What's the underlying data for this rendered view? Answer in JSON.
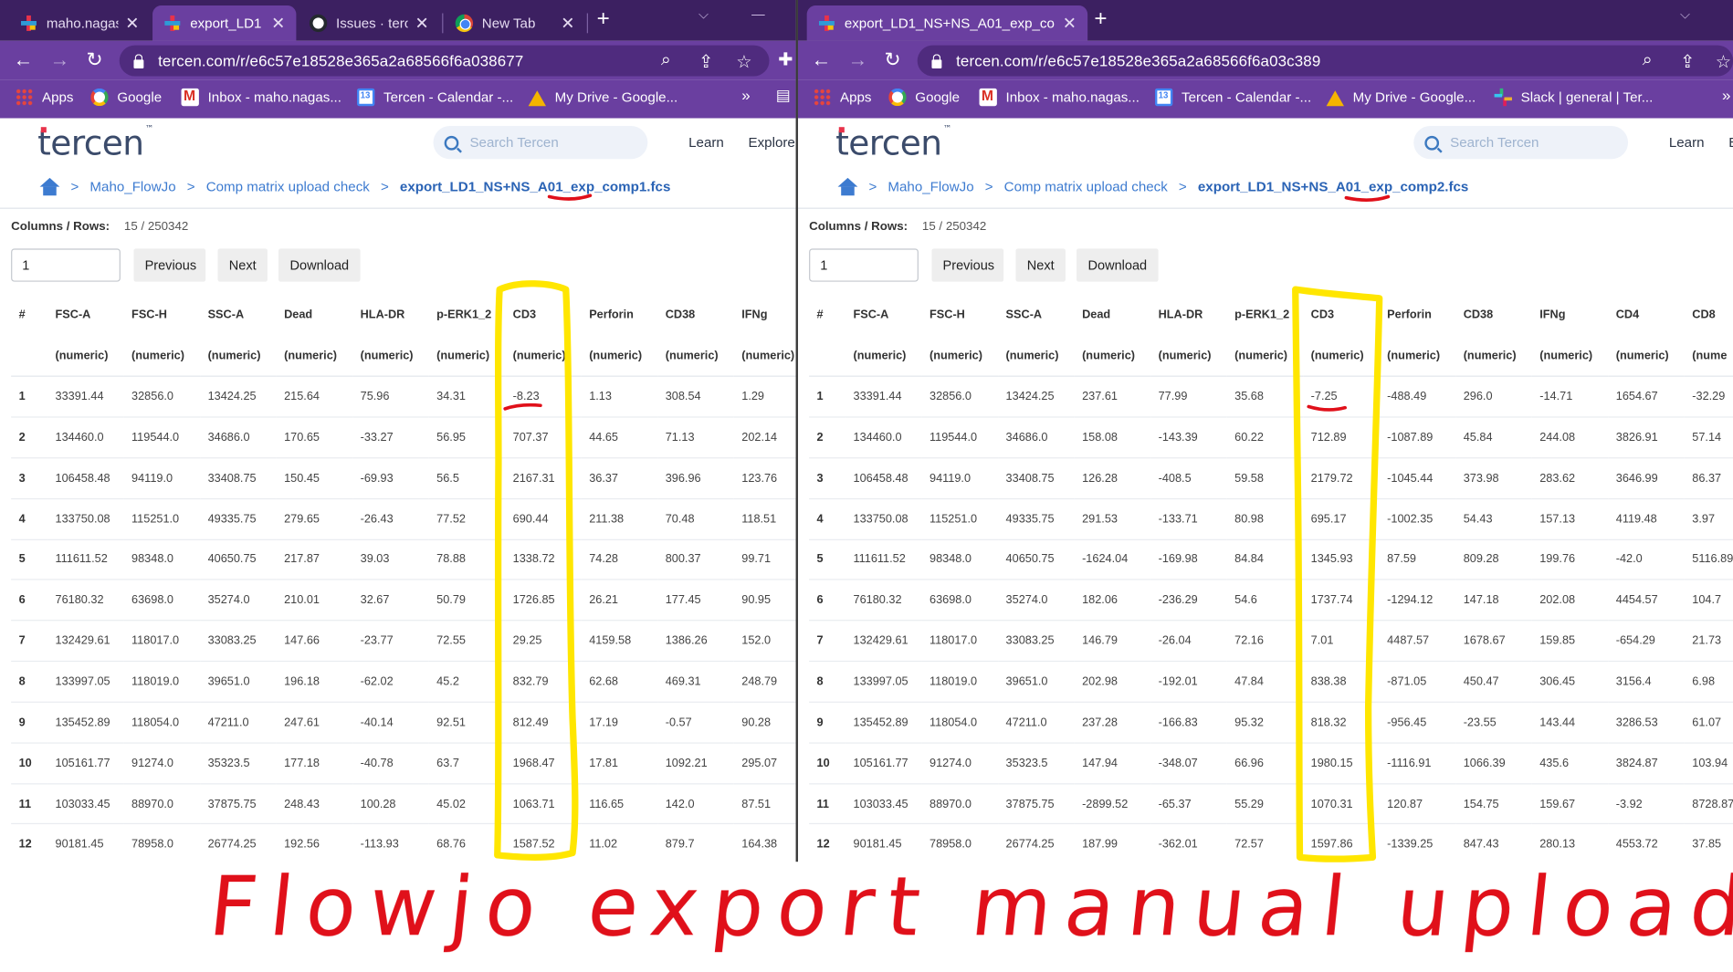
{
  "left_window": {
    "tabs": [
      {
        "title": "maho.nagas",
        "icon": "tercen",
        "active": false
      },
      {
        "title": "export_LD1",
        "icon": "tercen",
        "active": true
      },
      {
        "title": "Issues · terc",
        "icon": "github",
        "active": false
      },
      {
        "title": "New Tab",
        "icon": "chrome",
        "active": false
      }
    ],
    "url": "tercen.com/r/e6c57e18528e365a2a68566f6a038677",
    "bookmarks": [
      "Apps",
      "Google",
      "Inbox - maho.nagas...",
      "Tercen - Calendar -...",
      "My Drive - Google..."
    ],
    "bookmarks_more": "»",
    "page": {
      "search_placeholder": "Search Tercen",
      "nav": [
        "Learn",
        "Explore"
      ],
      "breadcrumb": [
        "Maho_FlowJo",
        "Comp matrix upload check"
      ],
      "breadcrumb_current": "export_LD1_NS+NS_A01_exp_comp1.fcs",
      "columns_rows_label": "Columns / Rows:",
      "columns_rows_value": "15 / 250342",
      "pager_value": "1",
      "buttons": [
        "Previous",
        "Next",
        "Download"
      ],
      "columns": [
        "#",
        "FSC-A",
        "FSC-H",
        "SSC-A",
        "Dead",
        "HLA-DR",
        "p-ERK1_2",
        "CD3",
        "Perforin",
        "CD38",
        "IFNg"
      ],
      "types": [
        "",
        "(numeric)",
        "(numeric)",
        "(numeric)",
        "(numeric)",
        "(numeric)",
        "(numeric)",
        "(numeric)",
        "(numeric)",
        "(numeric)",
        "(numeric)"
      ],
      "rows": [
        [
          "1",
          "33391.44",
          "32856.0",
          "13424.25",
          "215.64",
          "75.96",
          "34.31",
          "-8.23",
          "1.13",
          "308.54",
          "1.29"
        ],
        [
          "2",
          "134460.0",
          "119544.0",
          "34686.0",
          "170.65",
          "-33.27",
          "56.95",
          "707.37",
          "44.65",
          "71.13",
          "202.14"
        ],
        [
          "3",
          "106458.48",
          "94119.0",
          "33408.75",
          "150.45",
          "-69.93",
          "56.5",
          "2167.31",
          "36.37",
          "396.96",
          "123.76"
        ],
        [
          "4",
          "133750.08",
          "115251.0",
          "49335.75",
          "279.65",
          "-26.43",
          "77.52",
          "690.44",
          "211.38",
          "70.48",
          "118.51"
        ],
        [
          "5",
          "111611.52",
          "98348.0",
          "40650.75",
          "217.87",
          "39.03",
          "78.88",
          "1338.72",
          "74.28",
          "800.37",
          "99.71"
        ],
        [
          "6",
          "76180.32",
          "63698.0",
          "35274.0",
          "210.01",
          "32.67",
          "50.79",
          "1726.85",
          "26.21",
          "177.45",
          "90.95"
        ],
        [
          "7",
          "132429.61",
          "118017.0",
          "33083.25",
          "147.66",
          "-23.77",
          "72.55",
          "29.25",
          "4159.58",
          "1386.26",
          "152.0"
        ],
        [
          "8",
          "133997.05",
          "118019.0",
          "39651.0",
          "196.18",
          "-62.02",
          "45.2",
          "832.79",
          "62.68",
          "469.31",
          "248.79"
        ],
        [
          "9",
          "135452.89",
          "118054.0",
          "47211.0",
          "247.61",
          "-40.14",
          "92.51",
          "812.49",
          "17.19",
          "-0.57",
          "90.28"
        ],
        [
          "10",
          "105161.77",
          "91274.0",
          "35323.5",
          "177.18",
          "-40.78",
          "63.7",
          "1968.47",
          "17.81",
          "1092.21",
          "295.07"
        ],
        [
          "11",
          "103033.45",
          "88970.0",
          "37875.75",
          "248.43",
          "100.28",
          "45.02",
          "1063.71",
          "116.65",
          "142.0",
          "87.51"
        ],
        [
          "12",
          "90181.45",
          "78958.0",
          "26774.25",
          "192.56",
          "-113.93",
          "68.76",
          "1587.52",
          "11.02",
          "879.7",
          "164.38"
        ]
      ]
    }
  },
  "right_window": {
    "tabs": [
      {
        "title": "export_LD1_NS+NS_A01_exp_co",
        "icon": "tercen",
        "active": true
      }
    ],
    "url": "tercen.com/r/e6c57e18528e365a2a68566f6a03c389",
    "bookmarks": [
      "Apps",
      "Google",
      "Inbox - maho.nagas...",
      "Tercen - Calendar -...",
      "My Drive - Google...",
      "Slack | general | Ter..."
    ],
    "bookmarks_more": "»",
    "page": {
      "search_placeholder": "Search Tercen",
      "nav": [
        "Learn",
        "E"
      ],
      "breadcrumb": [
        "Maho_FlowJo",
        "Comp matrix upload check"
      ],
      "breadcrumb_current": "export_LD1_NS+NS_A01_exp_comp2.fcs",
      "columns_rows_label": "Columns / Rows:",
      "columns_rows_value": "15 / 250342",
      "pager_value": "1",
      "buttons": [
        "Previous",
        "Next",
        "Download"
      ],
      "columns": [
        "#",
        "FSC-A",
        "FSC-H",
        "SSC-A",
        "Dead",
        "HLA-DR",
        "p-ERK1_2",
        "CD3",
        "Perforin",
        "CD38",
        "IFNg",
        "CD4",
        "CD8"
      ],
      "types": [
        "",
        "(numeric)",
        "(numeric)",
        "(numeric)",
        "(numeric)",
        "(numeric)",
        "(numeric)",
        "(numeric)",
        "(numeric)",
        "(numeric)",
        "(numeric)",
        "(numeric)",
        "(nume"
      ],
      "rows": [
        [
          "1",
          "33391.44",
          "32856.0",
          "13424.25",
          "237.61",
          "77.99",
          "35.68",
          "-7.25",
          "-488.49",
          "296.0",
          "-14.71",
          "1654.67",
          "-32.29"
        ],
        [
          "2",
          "134460.0",
          "119544.0",
          "34686.0",
          "158.08",
          "-143.39",
          "60.22",
          "712.89",
          "-1087.89",
          "45.84",
          "244.08",
          "3826.91",
          "57.14"
        ],
        [
          "3",
          "106458.48",
          "94119.0",
          "33408.75",
          "126.28",
          "-408.5",
          "59.58",
          "2179.72",
          "-1045.44",
          "373.98",
          "283.62",
          "3646.99",
          "86.37"
        ],
        [
          "4",
          "133750.08",
          "115251.0",
          "49335.75",
          "291.53",
          "-133.71",
          "80.98",
          "695.17",
          "-1002.35",
          "54.43",
          "157.13",
          "4119.48",
          "3.97"
        ],
        [
          "5",
          "111611.52",
          "98348.0",
          "40650.75",
          "-1624.04",
          "-169.98",
          "84.84",
          "1345.93",
          "87.59",
          "809.28",
          "199.76",
          "-42.0",
          "5116.89"
        ],
        [
          "6",
          "76180.32",
          "63698.0",
          "35274.0",
          "182.06",
          "-236.29",
          "54.6",
          "1737.74",
          "-1294.12",
          "147.18",
          "202.08",
          "4454.57",
          "104.7"
        ],
        [
          "7",
          "132429.61",
          "118017.0",
          "33083.25",
          "146.79",
          "-26.04",
          "72.16",
          "7.01",
          "4487.57",
          "1678.67",
          "159.85",
          "-654.29",
          "21.73"
        ],
        [
          "8",
          "133997.05",
          "118019.0",
          "39651.0",
          "202.98",
          "-192.01",
          "47.84",
          "838.38",
          "-871.05",
          "450.47",
          "306.45",
          "3156.4",
          "6.98"
        ],
        [
          "9",
          "135452.89",
          "118054.0",
          "47211.0",
          "237.28",
          "-166.83",
          "95.32",
          "818.32",
          "-956.45",
          "-23.55",
          "143.44",
          "3286.53",
          "61.07"
        ],
        [
          "10",
          "105161.77",
          "91274.0",
          "35323.5",
          "147.94",
          "-348.07",
          "66.96",
          "1980.15",
          "-1116.91",
          "1066.39",
          "435.6",
          "3824.87",
          "103.94"
        ],
        [
          "11",
          "103033.45",
          "88970.0",
          "37875.75",
          "-2899.52",
          "-65.37",
          "55.29",
          "1070.31",
          "120.87",
          "154.75",
          "159.67",
          "-3.92",
          "8728.87"
        ],
        [
          "12",
          "90181.45",
          "78958.0",
          "26774.25",
          "187.99",
          "-362.01",
          "72.57",
          "1597.86",
          "-1339.25",
          "847.43",
          "280.13",
          "4553.72",
          "37.85"
        ]
      ]
    }
  },
  "annotation": {
    "caption": "Flowjo export manual upload to Tercen",
    "highlight_color": "#ffe600",
    "ink_color": "#e0101a"
  }
}
